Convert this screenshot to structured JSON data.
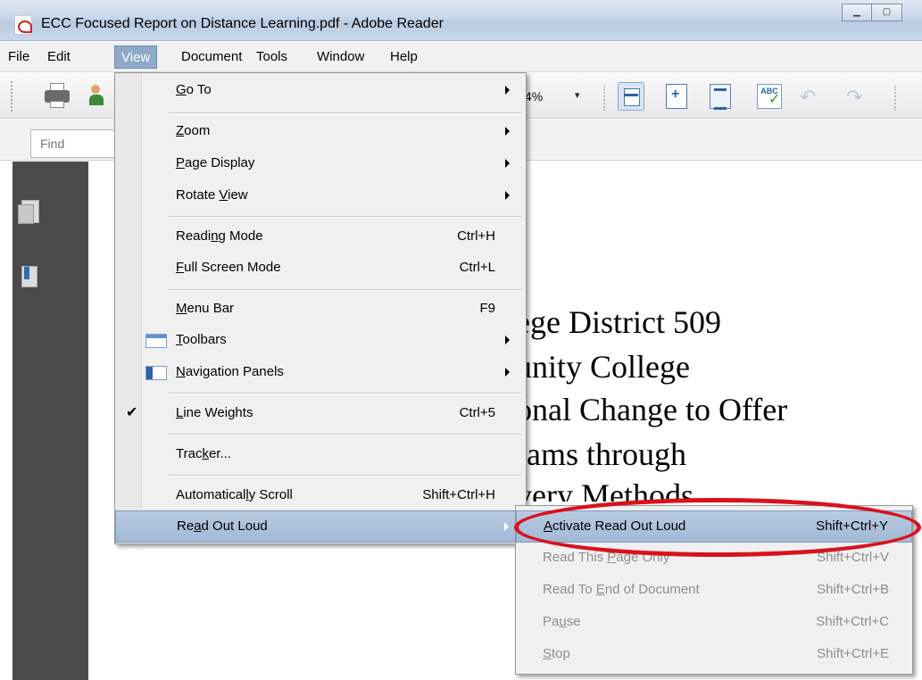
{
  "window": {
    "title": "ECC Focused Report on Distance Learning.pdf - Adobe Reader",
    "buttons": [
      "▁",
      "▢"
    ]
  },
  "menubar": {
    "items": [
      "File",
      "Edit",
      "View",
      "Document",
      "Tools",
      "Window",
      "Help"
    ],
    "active": "View"
  },
  "toolbar": {
    "zoom_value": "4%",
    "zoom_dropdown": "▾"
  },
  "findbar": {
    "placeholder": "Find"
  },
  "document": {
    "lines": [
      "ege District 509",
      "unity College",
      "onal Change to Offer",
      "rams through",
      "very Methods"
    ]
  },
  "view_menu": {
    "items": [
      {
        "label_pre": "",
        "label_u": "G",
        "label_post": "o To",
        "shortcut": "",
        "submenu": true
      },
      {
        "label_pre": "",
        "label_u": "Z",
        "label_post": "oom",
        "shortcut": "",
        "submenu": true
      },
      {
        "label_pre": "",
        "label_u": "P",
        "label_post": "age Display",
        "shortcut": "",
        "submenu": true
      },
      {
        "label_pre": "Rotate ",
        "label_u": "V",
        "label_post": "iew",
        "shortcut": "",
        "submenu": true
      },
      {
        "label_pre": "Readi",
        "label_u": "n",
        "label_post": "g Mode",
        "shortcut": "Ctrl+H",
        "submenu": false
      },
      {
        "label_pre": "",
        "label_u": "F",
        "label_post": "ull Screen Mode",
        "shortcut": "Ctrl+L",
        "submenu": false
      },
      {
        "label_pre": "",
        "label_u": "M",
        "label_post": "enu Bar",
        "shortcut": "F9",
        "submenu": false
      },
      {
        "label_pre": "",
        "label_u": "T",
        "label_post": "oolbars",
        "shortcut": "",
        "submenu": true
      },
      {
        "label_pre": "",
        "label_u": "N",
        "label_post": "avigation Panels",
        "shortcut": "",
        "submenu": true
      },
      {
        "label_pre": "",
        "label_u": "L",
        "label_post": "ine Weights",
        "shortcut": "Ctrl+5",
        "submenu": false,
        "checked": "✔"
      },
      {
        "label_pre": "Trac",
        "label_u": "k",
        "label_post": "er...",
        "shortcut": "",
        "submenu": false
      },
      {
        "label_pre": "Automatical",
        "label_u": "l",
        "label_post": "y Scroll",
        "shortcut": "Shift+Ctrl+H",
        "submenu": false
      },
      {
        "label_pre": "Re",
        "label_u": "a",
        "label_post": "d Out Loud",
        "shortcut": "",
        "submenu": true
      }
    ]
  },
  "read_out_loud_menu": {
    "items": [
      {
        "label_pre": "",
        "label_u": "A",
        "label_post": "ctivate Read Out Loud",
        "shortcut": "Shift+Ctrl+Y",
        "enabled": true
      },
      {
        "label_pre": "Read This ",
        "label_u": "P",
        "label_post": "age Only",
        "shortcut": "Shift+Ctrl+V",
        "enabled": false
      },
      {
        "label_pre": "Read To ",
        "label_u": "E",
        "label_post": "nd of Document",
        "shortcut": "Shift+Ctrl+B",
        "enabled": false
      },
      {
        "label_pre": "Pa",
        "label_u": "u",
        "label_post": "se",
        "shortcut": "Shift+Ctrl+C",
        "enabled": false
      },
      {
        "label_pre": "",
        "label_u": "S",
        "label_post": "top",
        "shortcut": "Shift+Ctrl+E",
        "enabled": false
      }
    ]
  },
  "colors": {
    "menu_highlight": "#a2b9d6",
    "annotation_red": "#d8121d",
    "nav_panel": "#4b4b4b"
  }
}
